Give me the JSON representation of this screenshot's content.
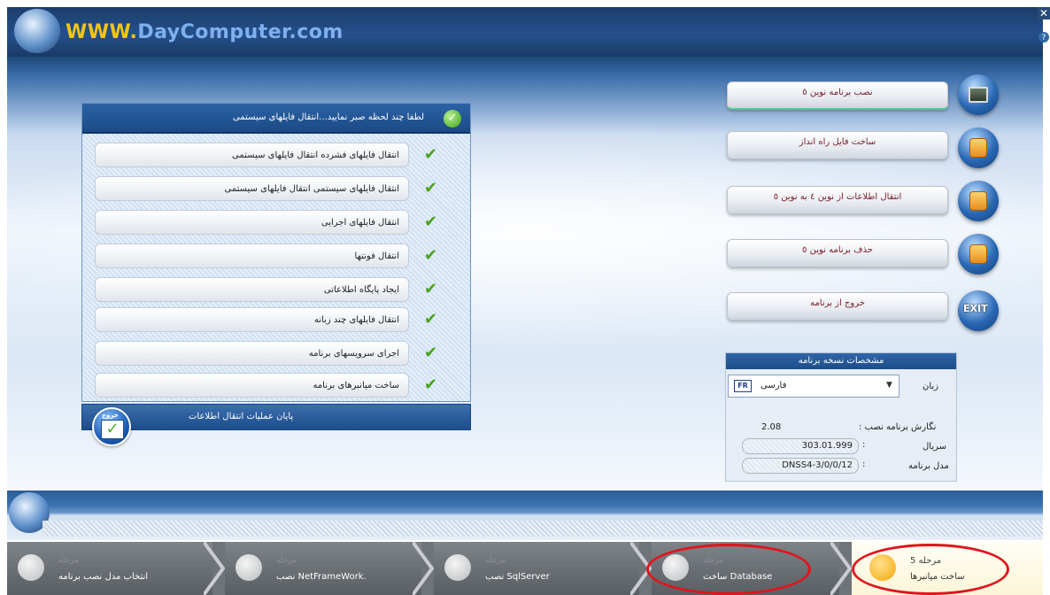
{
  "header": {
    "site_prefix": "WWW.",
    "site_name": "DayComputer.com",
    "close_glyph": "✕",
    "help_glyph": "?"
  },
  "panel": {
    "title": "لطفا چند لحظه صبر نمایید...انتقال فایلهای سیستمی",
    "tasks": [
      "انتقال فایلهای فشرده     انتقال فایلهای سیستمی",
      "انتقال فایلهای سیستمی انتقال فایلهای سیستمی",
      "انتقال فایلهای اجرایی",
      "انتقال فونتها",
      "ایجاد پایگاه اطلاعاتی",
      "انتقال فایلهای چند زبانه",
      "اجرای سرویسهای برنامه",
      "ساخت میانبرهای برنامه"
    ],
    "check_glyph": "✔",
    "footer_text": "پایان عملیات انتقال اطلاعات",
    "ok_label": "خروج"
  },
  "menu": {
    "items": [
      {
        "label": "نصب برنامه نوین ٥",
        "icon": "monitor-icon"
      },
      {
        "label": "ساخت فایل راه انداز",
        "icon": "lock-icon"
      },
      {
        "label": "انتقال اطلاعات از نوین ٤ به نوین ٥",
        "icon": "lock-icon"
      },
      {
        "label": "حذف برنامه نوین ٥",
        "icon": "lock-icon"
      },
      {
        "label": "خروج از برنامه",
        "icon": "exit-icon"
      }
    ],
    "exit_text": "EXIT"
  },
  "info": {
    "title": "مشخصات نسخه برنامه",
    "language_label": "زبان",
    "language_value": "فارسی",
    "language_flag": "FR",
    "dropdown_glyph": "▼",
    "version_label": "نگارش برنامه نصب :",
    "version_value": "2.08",
    "serial_label": "سریال",
    "serial_value": "303.01.999",
    "model_label": "مدل برنامه",
    "model_value": "DNSS4-3/0/0/12",
    "colon": ":"
  },
  "steps": [
    {
      "title": "مرحله",
      "label": "انتخاب مدل نصب برنامه"
    },
    {
      "title": "مرحله",
      "label": "نصب NetFrameWork."
    },
    {
      "title": "مرحله",
      "label": "نصب SqlServer"
    },
    {
      "title": "مرحله",
      "label": "ساخت Database"
    },
    {
      "title": "مرحله 5",
      "label": "ساخت میانبرها"
    }
  ],
  "colors": {
    "accent": "#1d4c8a",
    "check": "#4aa11e",
    "highlight_circle": "#e0141c"
  }
}
